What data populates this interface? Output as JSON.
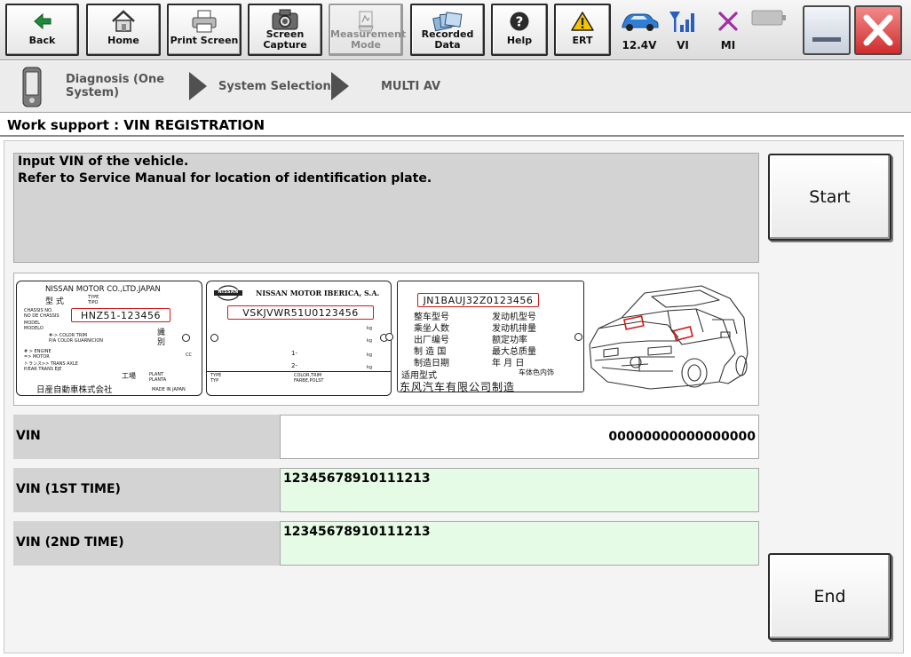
{
  "toolbar": {
    "buttons": [
      {
        "label": "Back",
        "icon": "back-arrow-icon"
      },
      {
        "label": "Home",
        "icon": "home-icon"
      },
      {
        "label": "Print Screen",
        "icon": "printer-icon"
      },
      {
        "label_line1": "Screen",
        "label_line2": "Capture",
        "icon": "camera-icon"
      },
      {
        "label_line1": "Measurement",
        "label_line2": "Mode",
        "icon": "measurement-icon",
        "enabled": false
      },
      {
        "label_line1": "Recorded",
        "label_line2": "Data",
        "icon": "recorded-data-icon"
      },
      {
        "label": "Help",
        "icon": "help-icon"
      },
      {
        "label": "ERT",
        "icon": "warning-icon"
      }
    ],
    "status": [
      {
        "label": "12.4V",
        "icon": "car-battery-icon"
      },
      {
        "label": "VI",
        "icon": "signal-antenna-icon"
      },
      {
        "label": "MI",
        "icon": "mi-cross-icon"
      },
      {
        "label": "",
        "icon": "battery-icon"
      }
    ]
  },
  "breadcrumb": {
    "step1_line1": "Diagnosis (One",
    "step1_line2": "System)",
    "step2": "System Selection",
    "step3": "MULTI AV"
  },
  "page": {
    "title": "Work support : VIN REGISTRATION",
    "instruction_line1": "Input VIN of the vehicle.",
    "instruction_line2": "Refer to Service Manual for location of identification plate."
  },
  "plates": {
    "plate1": {
      "header": "NISSAN MOTOR CO.,LTD.JAPAN",
      "type_label": "型  式",
      "type_sub1": "TYPE",
      "type_sub2": "TIPO",
      "chassis_lbl1": "CHASSIS NO.",
      "chassis_lbl2": "NO DE CHASSIS",
      "model_lbl": "MODEL",
      "modelo_lbl": "MODELO",
      "vin": "HNZ51-123456",
      "color_trim": "#-> COLOR TRIM",
      "color_garnicion": "P/A COLOR GUARNICION",
      "engine": "# > ENGINE",
      "motor": "=> MOTOR",
      "trans_axle": "トランス>> TRANS AXLE",
      "trans_eje": "P/EAR TRANS EJE",
      "japan_kanji": "識",
      "japan_kanji2": "別",
      "cc": "CC",
      "factory": "工場",
      "plant": "PLANT",
      "planta": "PLANTA",
      "footer": "日産自動車株式会社",
      "made_in": "MADE IN JAPAN"
    },
    "plate2": {
      "logo": "NISSAN",
      "header": "NISSAN MOTOR IBERICA, S.A.",
      "vin": "VSKJVWR51U0123456",
      "kg1": "kg",
      "kg2": "kg",
      "kg3": "kg",
      "kg4": "kg",
      "row1": "1-",
      "row2": "2-",
      "type_lbl": "TYPE",
      "typ_lbl": "TYP",
      "color_trim": "COLOR,TRIM",
      "farbe": "FARBE,POLST"
    },
    "plate3": {
      "vin": "JN1BAUJ32Z0123456",
      "l1": "整车型号",
      "l2": "乘坐人数",
      "l3": "出厂编号",
      "l4": "制 造 国",
      "l5": "制造日期",
      "r1": "发动机型号",
      "r2": "发动机排量",
      "r3": "额定功率",
      "r4": "最大总质量",
      "r5": "年      月      日",
      "l6": "适用型式",
      "r6": "车体色内饰",
      "footer": "东风汽车有限公司制造"
    }
  },
  "fields": {
    "vin": {
      "label": "VIN",
      "value": "00000000000000000"
    },
    "vin1": {
      "label": "VIN (1ST TIME)",
      "value": "12345678910111213"
    },
    "vin2": {
      "label": "VIN (2ND TIME)",
      "value": "12345678910111213"
    }
  },
  "actions": {
    "start": "Start",
    "end": "End"
  },
  "colors": {
    "input_bg": "#e6fbe6",
    "label_bg": "#d3d3d3",
    "highlight_red": "#d11a1a",
    "close_red": "#e23b3b"
  }
}
